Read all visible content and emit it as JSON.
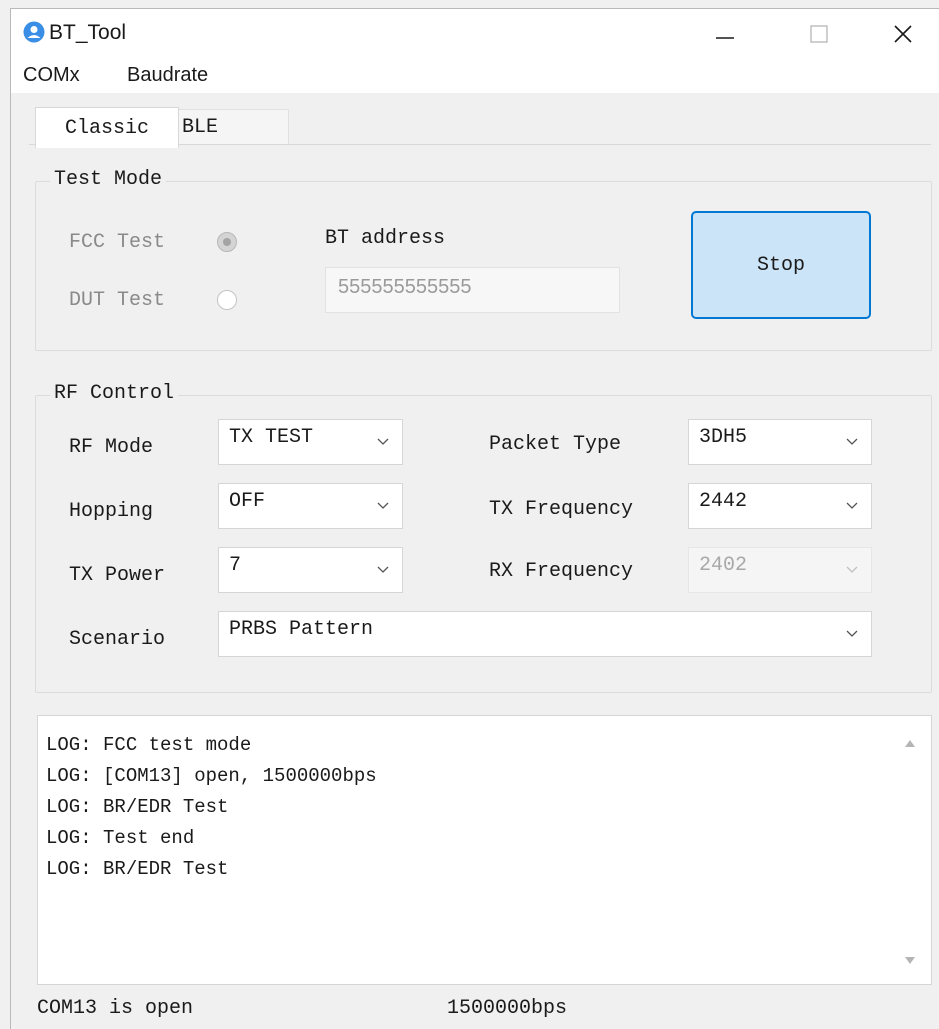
{
  "window": {
    "title": "BT_Tool"
  },
  "menu": {
    "items": [
      "COMx",
      "Baudrate"
    ]
  },
  "tabs": [
    {
      "label": "Classic",
      "active": true
    },
    {
      "label": "BLE",
      "active": false
    }
  ],
  "test_mode": {
    "title": "Test Mode",
    "fcc_label": "FCC Test",
    "dut_label": "DUT Test",
    "selected": "FCC Test",
    "bt_address_label": "BT address",
    "bt_address_value": "555555555555",
    "stop_label": "Stop"
  },
  "rf_control": {
    "title": "RF Control",
    "rf_mode_label": "RF Mode",
    "rf_mode_value": "TX TEST",
    "hopping_label": "Hopping",
    "hopping_value": "OFF",
    "tx_power_label": "TX Power",
    "tx_power_value": "7",
    "scenario_label": "Scenario",
    "scenario_value": "PRBS Pattern",
    "packet_type_label": "Packet Type",
    "packet_type_value": "3DH5",
    "tx_freq_label": "TX Frequency",
    "tx_freq_value": "2442",
    "rx_freq_label": "RX Frequency",
    "rx_freq_value": "2402"
  },
  "log": {
    "lines": [
      "LOG: FCC test mode",
      "LOG: [COM13] open, 1500000bps",
      "LOG: BR/EDR Test",
      "LOG: Test end",
      "LOG: BR/EDR Test"
    ]
  },
  "status": {
    "port": "COM13 is open",
    "baud": "1500000bps"
  },
  "colors": {
    "accent": "#0078d4",
    "button_fill": "#cce4f7",
    "background": "#f0f0f0"
  },
  "icons": [
    "app-icon",
    "minimize-icon",
    "maximize-icon",
    "close-icon",
    "chevron-down-icon",
    "scroll-up-arrow-icon",
    "scroll-down-arrow-icon"
  ]
}
